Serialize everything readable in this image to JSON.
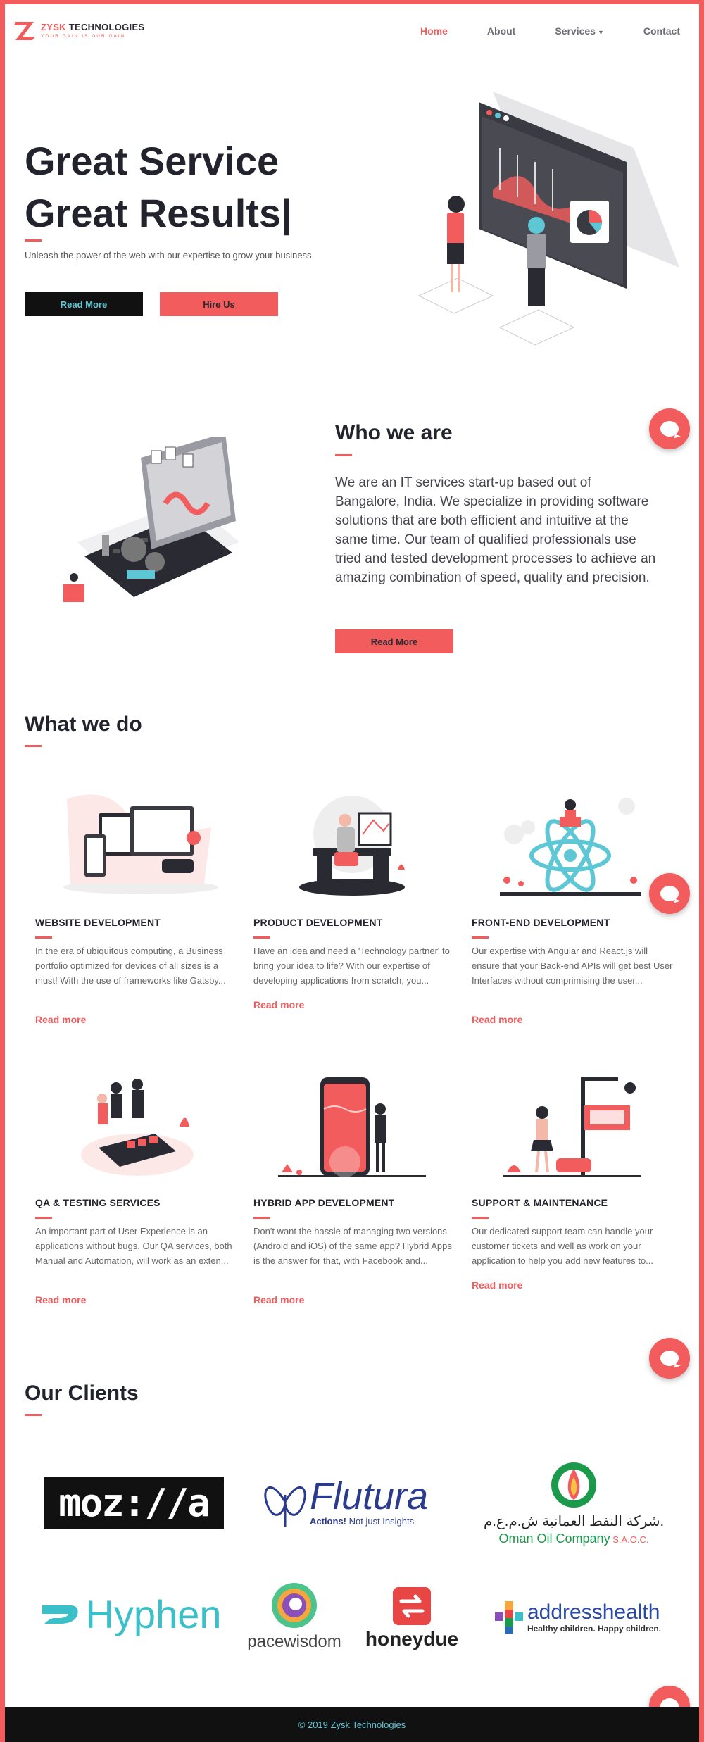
{
  "nav": {
    "logo_brand": "ZYSK",
    "logo_rest": " TECHNOLOGIES",
    "tagline": "YOUR GAIN IS OUR GAIN",
    "items": [
      {
        "label": "Home"
      },
      {
        "label": "About"
      },
      {
        "label": "Services"
      },
      {
        "label": "Contact"
      }
    ]
  },
  "hero": {
    "title_line1": "Great Service",
    "title_line2": "Great Results|",
    "subtitle": "Unleash the power of the web with our expertise to grow your business.",
    "read_more": "Read More",
    "hire_us": "Hire Us"
  },
  "who": {
    "title": "Who we are",
    "text": "We are an IT services start-up based out of Bangalore, India. We specialize in providing software solutions that are both efficient and intuitive at the same time. Our team of qualified professionals use tried and tested development processes to achieve an amazing combination of speed, quality and precision.",
    "button": "Read More"
  },
  "what": {
    "title": "What we do",
    "services": [
      {
        "name": "WEBSITE DEVELOPMENT",
        "desc": "In the era of ubiquitous computing, a Business portfolio optimized for devices of all sizes is a must! With the use of frameworks like Gatsby...",
        "link": "Read more"
      },
      {
        "name": "PRODUCT DEVELOPMENT",
        "desc": "Have an idea and need a 'Technology partner' to bring your idea to life? With our expertise of developing applications from scratch, you...",
        "link": "Read more"
      },
      {
        "name": "FRONT-END DEVELOPMENT",
        "desc": "Our expertise with Angular and React.js will ensure that your Back-end APIs will get best User Interfaces without comprimising the user...",
        "link": "Read more"
      },
      {
        "name": "QA & TESTING SERVICES",
        "desc": "An important part of User Experience is an applications without bugs. Our QA services, both Manual and Automation, will work as an exten...",
        "link": "Read more"
      },
      {
        "name": "HYBRID APP DEVELOPMENT",
        "desc": "Don't want the hassle of managing two versions (Android and iOS) of the same app? Hybrid Apps is the answer for that, with Facebook and...",
        "link": "Read more"
      },
      {
        "name": "SUPPORT & MAINTENANCE",
        "desc": "Our dedicated support team can handle your customer tickets and well as work on your application to help you add new features to...",
        "link": "Read more"
      }
    ]
  },
  "clients": {
    "title": "Our Clients",
    "mozilla": "moz://a",
    "flutura": "Flutura",
    "flutura_tag_a": "Actions!",
    "flutura_tag_b": " Not just Insights",
    "oman_arabic": "شركة النفط العمانية ش.م.ع.م.",
    "oman_en": "Oman Oil Company",
    "oman_suffix": " S.A.O.C.",
    "hyphen": "Hyphen",
    "pacewisdom": "pacewisdom",
    "honeydue": "honeydue",
    "address": "addresshealth",
    "address_tag": "Healthy children. Happy children."
  },
  "footer": {
    "text": "© 2019 Zysk Technologies"
  },
  "colors": {
    "accent": "#f25c5c",
    "teal": "#5ec7d6",
    "dark": "#23232e"
  }
}
